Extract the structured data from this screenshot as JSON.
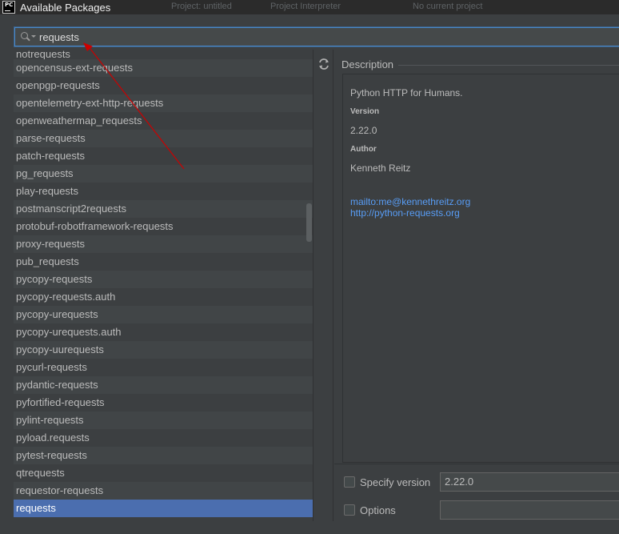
{
  "window": {
    "title": "Available Packages",
    "app_icon": "pycharm-icon",
    "background_crumbs": [
      "Project: untitled",
      "Project Interpreter",
      "No current project"
    ]
  },
  "search": {
    "value": "requests",
    "icon": "search-icon"
  },
  "packages": [
    "notrequests",
    "opencensus-ext-requests",
    "openpgp-requests",
    "opentelemetry-ext-http-requests",
    "openweathermap_requests",
    "parse-requests",
    "patch-requests",
    "pg_requests",
    "play-requests",
    "postmanscript2requests",
    "protobuf-robotframework-requests",
    "proxy-requests",
    "pub_requests",
    "pycopy-requests",
    "pycopy-requests.auth",
    "pycopy-urequests",
    "pycopy-urequests.auth",
    "pycopy-uurequests",
    "pycurl-requests",
    "pydantic-requests",
    "pyfortified-requests",
    "pylint-requests",
    "pyload.requests",
    "pytest-requests",
    "qtrequests",
    "requestor-requests",
    "requests"
  ],
  "selected_package": "requests",
  "refresh_icon": "refresh-icon",
  "description": {
    "header": "Description",
    "summary": "Python HTTP for Humans.",
    "version_label": "Version",
    "version": "2.22.0",
    "author_label": "Author",
    "author": "Kenneth Reitz",
    "email_link": "mailto:me@kennethreitz.org",
    "home_link": "http://python-requests.org"
  },
  "options": {
    "specify_version_label": "Specify version",
    "specify_version_value": "2.22.0",
    "options_label": "Options",
    "options_value": ""
  },
  "colors": {
    "selection": "#4b6eaf",
    "link": "#589df6",
    "annotation_arrow": "#cc0000",
    "focus_border": "#4a88c7"
  }
}
